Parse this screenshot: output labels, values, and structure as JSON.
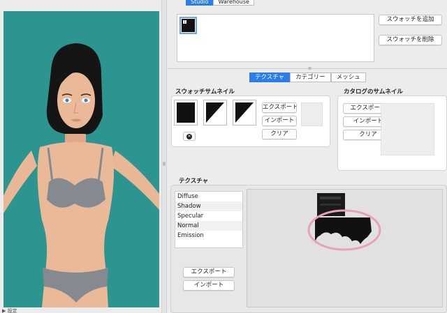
{
  "top_segment": {
    "studio": "Studio",
    "warehouse": "Warehouse"
  },
  "swatch_list": {
    "item_label": "1"
  },
  "swatch_buttons": {
    "add": "スウォッチを追加",
    "remove": "スウォッチを削除"
  },
  "tabs": [
    {
      "label": "テクスチャ",
      "active": true
    },
    {
      "label": "カテゴリー",
      "active": false
    },
    {
      "label": "メッシュ",
      "active": false
    }
  ],
  "swatch_thumbnail": {
    "title": "スウォッチサムネイル",
    "export": "エクスポート",
    "import": "インポート",
    "clear": "クリア"
  },
  "catalog_thumbnail": {
    "title": "カタログのサムネイル",
    "export": "エクスポート",
    "import": "インポート",
    "clear": "クリア"
  },
  "texture": {
    "title": "テクスチャ",
    "channels": [
      "Diffuse",
      "Shadow",
      "Specular",
      "Normal",
      "Emission"
    ],
    "export": "エクスポート",
    "import": "インポート"
  },
  "bottom_left": {
    "label": "▶ 設定"
  },
  "colors": {
    "viewport_bg": "#2d9590",
    "accent": "#2b7de9",
    "highlight_ellipse": "#e9a2b5"
  }
}
